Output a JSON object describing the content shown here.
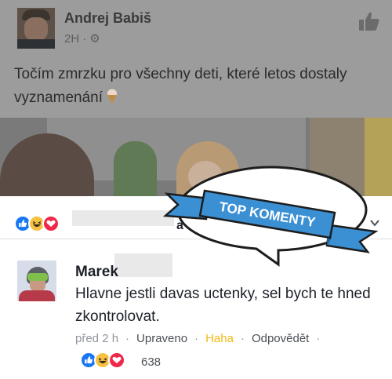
{
  "post": {
    "author": "Andrej Babiš",
    "time": "2H",
    "separator": "·",
    "text": "Točím zmrzku pro všechny deti, které letos dostaly vyznamenání",
    "icons": {
      "settings": "gear-icon",
      "like": "thumbs-up-icon",
      "emoji": "ice-cream-icon"
    }
  },
  "reactions_bar": {
    "and_more_text": "a další",
    "icons": [
      "like-reaction-icon",
      "haha-reaction-icon",
      "love-reaction-icon",
      "chevron-icon"
    ]
  },
  "badge": {
    "text": "TOP KOMENTY",
    "accent": "#3b8fd3"
  },
  "comment": {
    "name": "Marek",
    "text": "Hlavne jestli davas uctenky, sel bych te hned zkontrolovat.",
    "actions": {
      "time": "před 2 h",
      "sep": "·",
      "edited": "Upraveno",
      "haha": "Haha",
      "reply": "Odpovědět",
      "trailing_sep": "·"
    },
    "reaction_count": "638"
  },
  "colors": {
    "like_blue": "#1877f2",
    "haha_yellow": "#f7c244",
    "love_red": "#f0284a"
  }
}
